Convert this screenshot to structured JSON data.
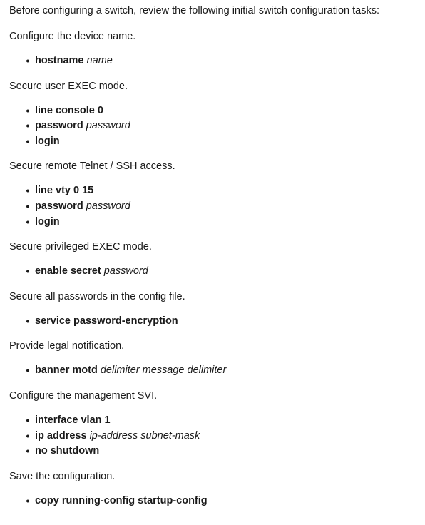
{
  "intro": "Before configuring a switch, review the following initial switch configuration tasks:",
  "tasks": [
    {
      "heading": "Configure the device name.",
      "commands": [
        {
          "keyword": "hostname",
          "arg": "name"
        }
      ]
    },
    {
      "heading": "Secure user EXEC mode.",
      "commands": [
        {
          "keyword": "line console 0",
          "arg": ""
        },
        {
          "keyword": "password",
          "arg": "password"
        },
        {
          "keyword": "login",
          "arg": ""
        }
      ]
    },
    {
      "heading": "Secure remote Telnet / SSH access.",
      "commands": [
        {
          "keyword": "line vty 0 15",
          "arg": ""
        },
        {
          "keyword": "password",
          "arg": "password"
        },
        {
          "keyword": "login",
          "arg": ""
        }
      ]
    },
    {
      "heading": "Secure privileged EXEC mode.",
      "commands": [
        {
          "keyword": "enable secret",
          "arg": "password"
        }
      ]
    },
    {
      "heading": "Secure all passwords in the config file.",
      "commands": [
        {
          "keyword": "service password-encryption",
          "arg": ""
        }
      ]
    },
    {
      "heading": "Provide legal notification.",
      "commands": [
        {
          "keyword": "banner motd",
          "arg": "delimiter message delimiter"
        }
      ]
    },
    {
      "heading": "Configure the management SVI.",
      "commands": [
        {
          "keyword": "interface vlan 1",
          "arg": ""
        },
        {
          "keyword": "ip address",
          "arg": "ip-address subnet-mask"
        },
        {
          "keyword": "no shutdown",
          "arg": ""
        }
      ]
    },
    {
      "heading": "Save the configuration.",
      "commands": [
        {
          "keyword": "copy running-config startup-config",
          "arg": ""
        }
      ]
    }
  ],
  "bullet_glyph": "•"
}
